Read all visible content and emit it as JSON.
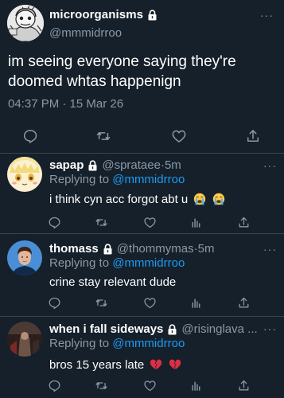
{
  "main_tweet": {
    "author_name": "microorganisms",
    "author_handle": "@mmmidrroo",
    "text": "im seeing everyone saying they're doomed whtas happenign",
    "timestamp": "04:37 PM · 15 Mar 26",
    "more_icon": "···"
  },
  "replies": [
    {
      "name": "sapap",
      "handle": "@sprataee",
      "time": "5m",
      "replying_label": "Replying to ",
      "replying_to": "@mmmidrroo",
      "text": "i think cyn acc forgot abt u",
      "emojis": [
        "loudly-crying-face",
        "loudly-crying-face"
      ],
      "more_icon": "···"
    },
    {
      "name": "thomass",
      "handle": "@thommymas",
      "time": "5m",
      "replying_label": "Replying to ",
      "replying_to": "@mmmidrroo",
      "text": "crine stay relevant dude",
      "emojis": [],
      "more_icon": "···"
    },
    {
      "name": "when i fall sideways",
      "handle": "@risinglava ...",
      "time": "",
      "replying_label": "Replying to ",
      "replying_to": "@mmmidrroo",
      "text": "bros 15 years late",
      "emojis": [
        "broken-heart",
        "broken-heart"
      ],
      "more_icon": "···"
    }
  ],
  "separator": " · ",
  "icons": [
    "lock-icon",
    "reply-icon",
    "retweet-icon",
    "like-icon",
    "share-icon",
    "analytics-icon",
    "more-icon"
  ],
  "colors": {
    "background": "#15202b",
    "secondary_text": "#8b98a5",
    "mention": "#1d9bf0",
    "divider": "#38444d"
  }
}
